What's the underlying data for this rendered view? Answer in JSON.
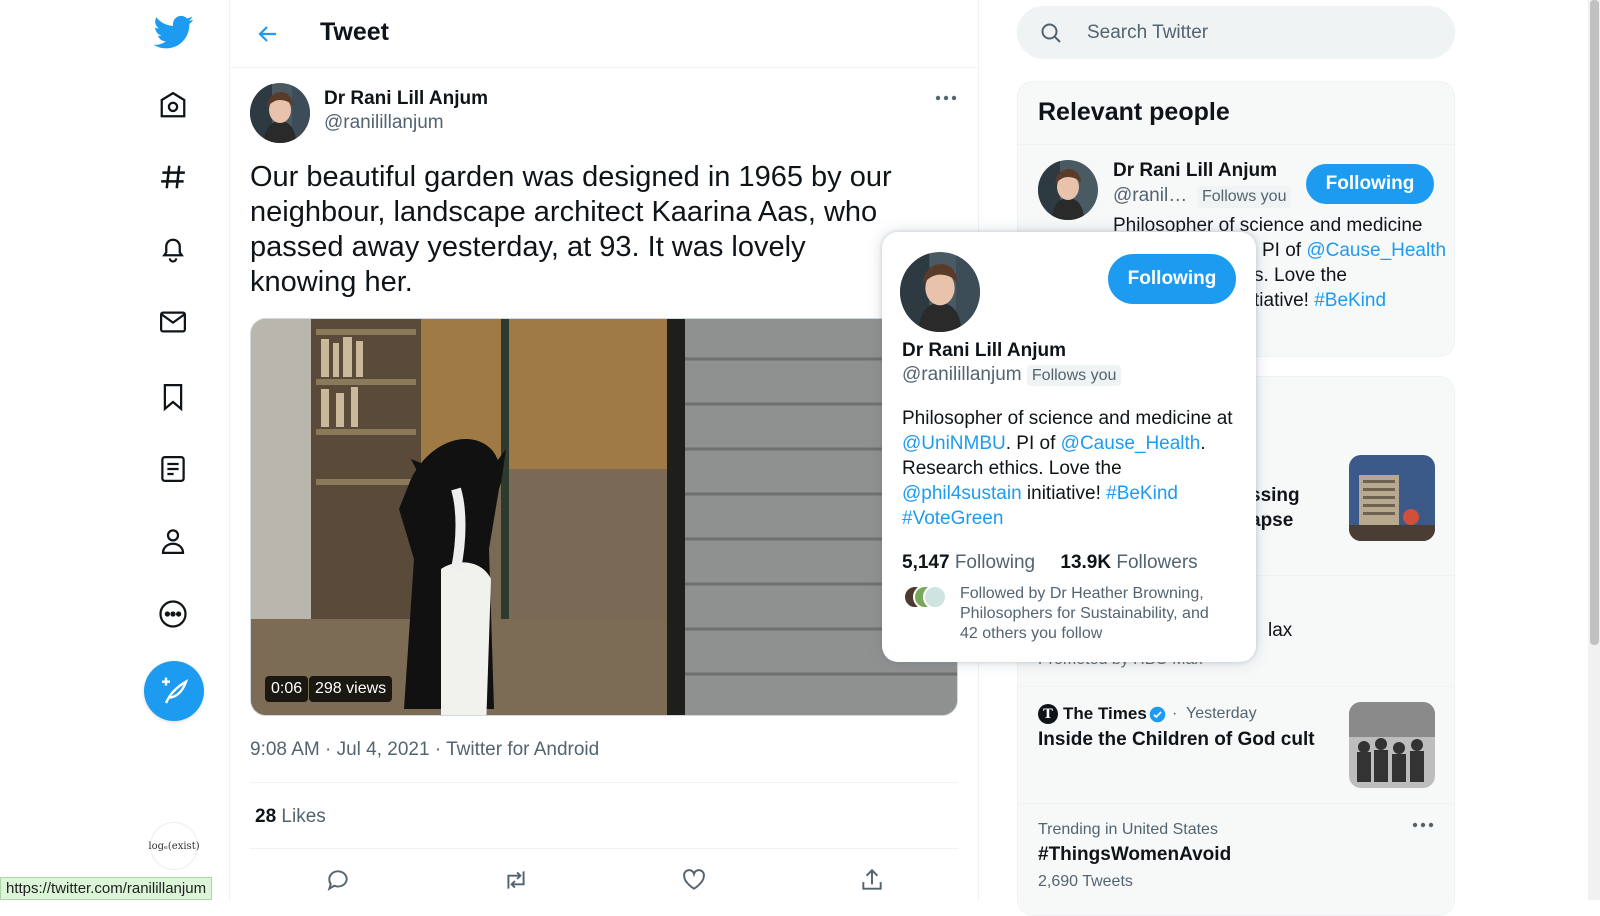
{
  "app": {
    "brand_color": "#1d9bf0"
  },
  "nav": {
    "items": [
      {
        "name": "home",
        "icon": "home-icon"
      },
      {
        "name": "explore",
        "icon": "hashtag-icon"
      },
      {
        "name": "notifications",
        "icon": "bell-icon"
      },
      {
        "name": "messages",
        "icon": "mail-icon"
      },
      {
        "name": "bookmarks",
        "icon": "bookmark-icon"
      },
      {
        "name": "lists",
        "icon": "list-icon"
      },
      {
        "name": "profile",
        "icon": "person-icon"
      },
      {
        "name": "more",
        "icon": "more-circle-icon"
      }
    ],
    "compose_icon": "feather-plus-icon",
    "account_avatar_text": "logₑ(exist)"
  },
  "header": {
    "title": "Tweet"
  },
  "tweet": {
    "author_name": "Dr Rani Lill Anjum",
    "author_handle": "@ranilillanjum",
    "text": "Our beautiful garden was designed in 1965 by our neighbour, landscape architect Kaarina Aas, who passed away yesterday, at 93. It was lovely knowing her.",
    "video_time": "0:06",
    "video_views": "298 views",
    "meta": "9:08 AM · Jul 4, 2021 · Twitter for Android",
    "likes_count": "28",
    "likes_label": "Likes"
  },
  "status_bar": {
    "url": "https://twitter.com/ranilillanjum"
  },
  "search": {
    "placeholder": "Search Twitter"
  },
  "relevant_people": {
    "title": "Relevant people",
    "name": "Dr Rani Lill Anjum",
    "handle": "@ranil…",
    "follows_you": "Follows you",
    "button": "Following",
    "bio_line1": "Philosopher of science and medicine",
    "bio_line2_pre": "PI of ",
    "bio_line2_link": "@Cause_Health",
    "bio_line3": "s. Love the",
    "bio_line4_pre": "tiative! ",
    "bio_line4_link": "#BeKind"
  },
  "trends": {
    "item1_title_part1": "ssing",
    "item1_title_part2": "apse",
    "item2_title_part": "lax",
    "item2_promoted": "Promoted by HBO Max",
    "item3_source": "The Times",
    "item3_time": "Yesterday",
    "item3_title": "Inside the Children of God cult",
    "item4_context": "Trending in United States",
    "item4_title": "#ThingsWomenAvoid",
    "item4_count": "2,690 Tweets"
  },
  "hovercard": {
    "button": "Following",
    "name": "Dr Rani Lill Anjum",
    "handle": "@ranilillanjum",
    "follows_you": "Follows you",
    "bio_1": "Philosopher of science and medicine at",
    "bio_link_unimbu": "@UniNMBU",
    "bio_pi": ". PI of ",
    "bio_link_cause": "@Cause_Health",
    "bio_dot": ".",
    "bio_3": "Research ethics. Love the",
    "bio_link_phil": "@phil4sustain",
    "bio_initiative": " initiative! ",
    "bio_link_bekind": "#BeKind",
    "bio_link_votegreen": "#VoteGreen",
    "following_count": "5,147",
    "following_label": "Following",
    "followers_count": "13.9K",
    "followers_label": "Followers",
    "followed_by": "Followed by Dr Heather Browning, Philosophers for Sustainability, and 42 others you follow"
  }
}
